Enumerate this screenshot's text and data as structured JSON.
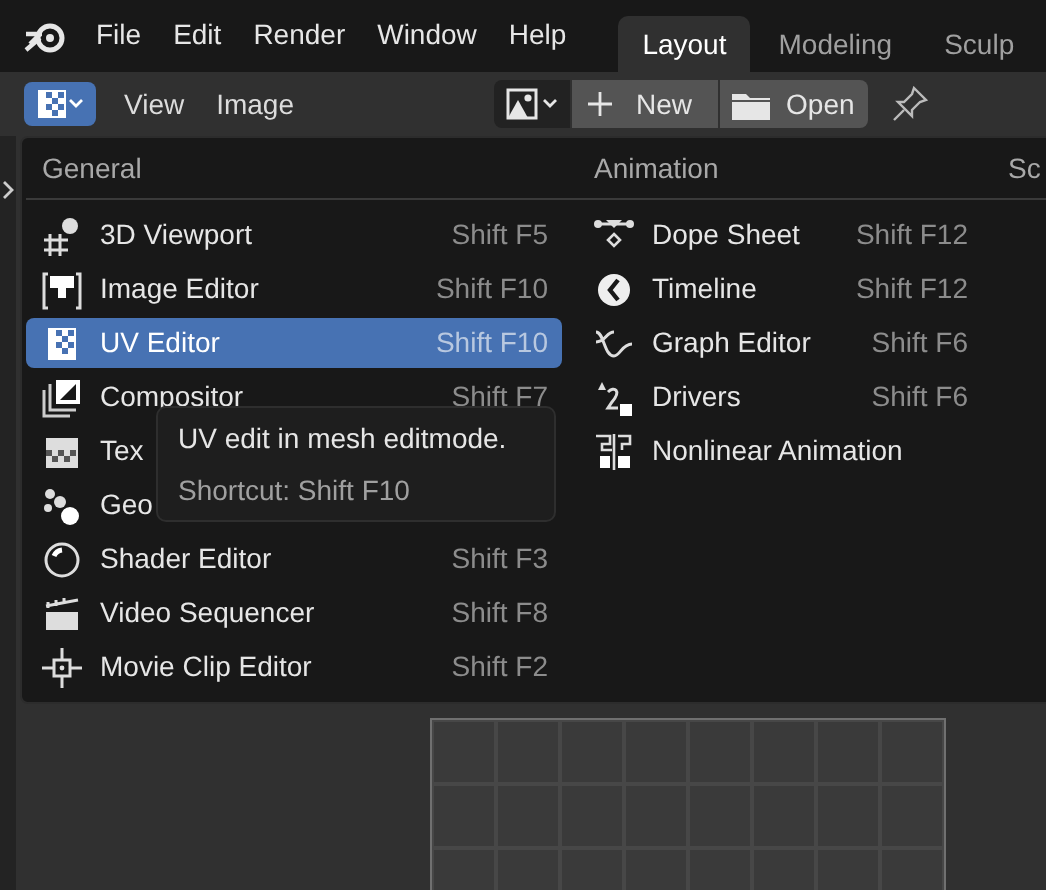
{
  "menu_bar": [
    "File",
    "Edit",
    "Render",
    "Window",
    "Help"
  ],
  "workspace_tabs": [
    {
      "label": "Layout",
      "selected": true
    },
    {
      "label": "Modeling",
      "selected": false
    },
    {
      "label": "Sculp",
      "selected": false
    }
  ],
  "header": {
    "menus": [
      "View",
      "Image"
    ],
    "new_button": "New",
    "open_button": "Open"
  },
  "editor_menu": {
    "columns": [
      {
        "title": "General",
        "items": [
          {
            "label": "3D Viewport",
            "shortcut": "Shift F5",
            "selected": false
          },
          {
            "label": "Image Editor",
            "shortcut": "Shift F10",
            "selected": false
          },
          {
            "label": "UV Editor",
            "shortcut": "Shift F10",
            "selected": true
          },
          {
            "label": "Compositor",
            "shortcut": "Shift F7",
            "selected": false
          },
          {
            "label": "Tex",
            "selected": false
          },
          {
            "label": "Geo",
            "selected": false
          },
          {
            "label": "Shader Editor",
            "shortcut": "Shift F3",
            "selected": false
          },
          {
            "label": "Video Sequencer",
            "shortcut": "Shift F8",
            "selected": false
          },
          {
            "label": "Movie Clip Editor",
            "shortcut": "Shift F2",
            "selected": false
          }
        ]
      },
      {
        "title": "Animation",
        "items": [
          {
            "label": "Dope Sheet",
            "shortcut": "Shift F12",
            "selected": false
          },
          {
            "label": "Timeline",
            "shortcut": "Shift F12",
            "selected": false
          },
          {
            "label": "Graph Editor",
            "shortcut": "Shift F6",
            "selected": false
          },
          {
            "label": "Drivers",
            "shortcut": "Shift F6",
            "selected": false
          },
          {
            "label": "Nonlinear Animation",
            "selected": false
          }
        ]
      },
      {
        "title": "Sc"
      }
    ]
  },
  "tooltip": {
    "description": "UV edit in mesh editmode.",
    "shortcut": "Shortcut: Shift F10"
  }
}
